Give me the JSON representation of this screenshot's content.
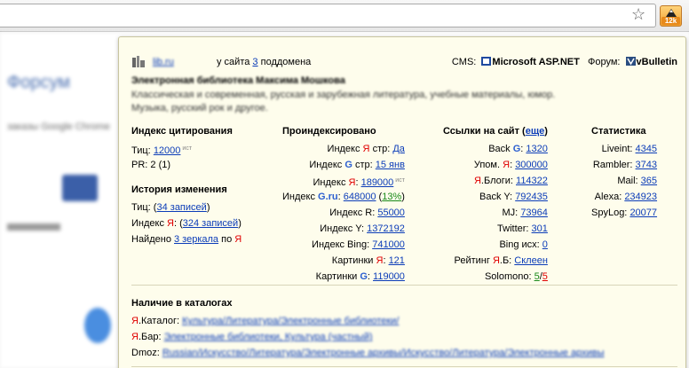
{
  "browser": {
    "star_icon": "star-icon",
    "extension_badge": "12k"
  },
  "background_page": {
    "heading": "Форсум",
    "subtext": "заказы Google Chrome"
  },
  "header": {
    "site_name": "lib.ru",
    "subdomains_prefix": "у сайта",
    "subdomains_count": "3",
    "subdomains_suffix": "поддомена",
    "cms_label": "CMS:",
    "cms_value": "Microsoft ASP.NET",
    "forum_label": "Форум:",
    "forum_value": "vBulletin"
  },
  "site": {
    "title": "Электронная библиотека Максима Мошкова",
    "description": "Классическая и современная, русская и зарубежная литература, учебные материалы, юмор. Музыка, русский рок и другое."
  },
  "citation": {
    "title": "Индекс цитирования",
    "tic_label": "Тиц:",
    "tic_value": "12000",
    "tic_sup": "ист",
    "pr_text": "PR: 2 (1)"
  },
  "history": {
    "title": "История изменения",
    "tic_label": "Тиц:",
    "tic_link": "34 записей",
    "index_label": "Индекс",
    "index_y": "Я",
    "index_link": "324 записей",
    "found_label": "Найдено",
    "found_link": "3 зеркала",
    "found_mid": "по",
    "found_y": "Я"
  },
  "indexed": {
    "title": "Проиндексировано",
    "rows": [
      {
        "label": "Индекс",
        "mark": "Я",
        "mark_type": "y",
        "after": "стр:",
        "value": "Да",
        "sup": "",
        "extra": ""
      },
      {
        "label": "Индекс",
        "mark": "G",
        "mark_type": "g",
        "after": "стр:",
        "value": "15 янв",
        "sup": "",
        "extra": ""
      },
      {
        "label": "Индекс",
        "mark": "Я",
        "mark_type": "y",
        "after": ":",
        "value": "189000",
        "sup": "ист",
        "extra": ""
      },
      {
        "label": "Индекс",
        "mark": "G.ru",
        "mark_type": "g",
        "after": ":",
        "value": "648000",
        "sup": "",
        "extra": "13%"
      },
      {
        "label": "Индекс R:",
        "mark": "",
        "mark_type": "",
        "after": "",
        "value": "55000",
        "sup": "",
        "extra": ""
      },
      {
        "label": "Индекс Y:",
        "mark": "",
        "mark_type": "",
        "after": "",
        "value": "1372192",
        "sup": "",
        "extra": ""
      },
      {
        "label": "Индекс Bing:",
        "mark": "",
        "mark_type": "",
        "after": "",
        "value": "741000",
        "sup": "",
        "extra": ""
      },
      {
        "label": "Картинки",
        "mark": "Я",
        "mark_type": "y",
        "after": ":",
        "value": "121",
        "sup": "",
        "extra": ""
      },
      {
        "label": "Картинки",
        "mark": "G",
        "mark_type": "g",
        "after": ":",
        "value": "119000",
        "sup": "",
        "extra": ""
      }
    ]
  },
  "links": {
    "title": "Ссылки на сайт",
    "title_more": "еще",
    "rows": [
      {
        "label": "Back",
        "mark": "G",
        "mark_type": "g",
        "after": ":",
        "value": "1320"
      },
      {
        "label": "Упом.",
        "mark": "Я",
        "mark_type": "y",
        "after": ":",
        "value": "300000"
      },
      {
        "label": "",
        "mark": "Я",
        "mark_type": "y",
        "after": ".Блоги:",
        "value": "114322"
      },
      {
        "label": "Back Y:",
        "mark": "",
        "mark_type": "",
        "after": "",
        "value": "792435"
      },
      {
        "label": "MJ:",
        "mark": "",
        "mark_type": "",
        "after": "",
        "value": "73964"
      },
      {
        "label": "Twitter:",
        "mark": "",
        "mark_type": "",
        "after": "",
        "value": "301"
      },
      {
        "label": "Bing исх:",
        "mark": "",
        "mark_type": "",
        "after": "",
        "value": "0"
      },
      {
        "label": "Рейтинг",
        "mark": "Я",
        "mark_type": "y",
        "after": ".Б:",
        "value": "Склеен"
      }
    ],
    "solomono_label": "Solomono:",
    "solomono_a": "5",
    "solomono_sep": "/",
    "solomono_b": "5"
  },
  "stats": {
    "title": "Статистика",
    "rows": [
      {
        "label": "Liveint:",
        "value": "4345"
      },
      {
        "label": "Rambler:",
        "value": "3743"
      },
      {
        "label": "Mail:",
        "value": "365"
      },
      {
        "label": "Alexa:",
        "value": "234923"
      },
      {
        "label": "SpyLog:",
        "value": "20077"
      }
    ]
  },
  "catalogs": {
    "title": "Наличие в каталогах",
    "yaca_mark": "Я",
    "yaca_label": ".Каталог:",
    "yaca_value": "Культура/Литература/Электронные библиотеки/",
    "yabar_mark": "Я",
    "yabar_label": ".Бар:",
    "yabar_value": "Электронные библиотеки, Культура (частный)",
    "dmoz_label": "Dmoz:",
    "dmoz_value": "Russian/Искусство/Литература/Электронные архивы/Искусство/Литература/Электронные архивы"
  },
  "colors": {
    "link": "#0b3cb8",
    "yandex_red": "#e00000",
    "google_blue": "#2c5fd0",
    "popup_bg": "#fefdec"
  }
}
